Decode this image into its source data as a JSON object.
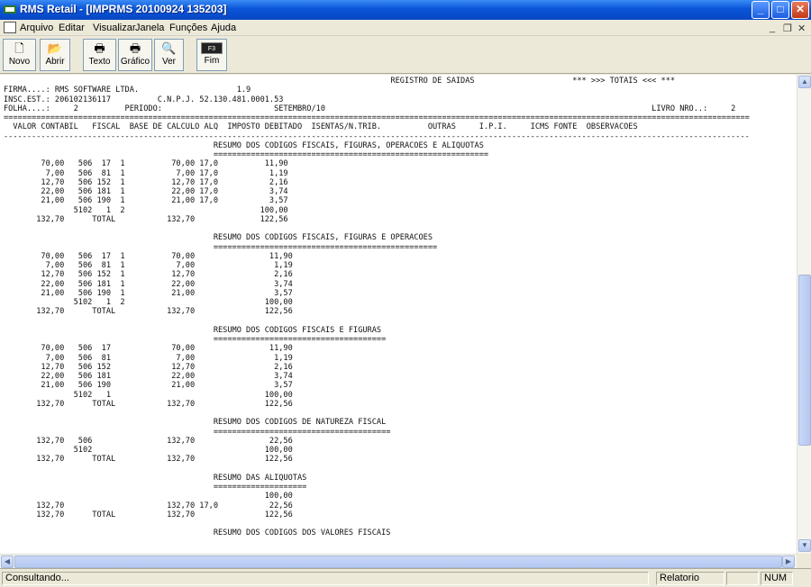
{
  "window": {
    "title": "RMS Retail - [IMPRMS 20100924 135203]",
    "controls": {
      "minimize": "_",
      "maximize": "□",
      "close": "✕"
    }
  },
  "menu": {
    "items": [
      "Arquivo",
      "Editar",
      "Visualizar",
      "Janela",
      "Funções",
      "Ajuda"
    ],
    "mdi_controls": {
      "minimize": "_",
      "restore": "❐",
      "close": "✕"
    }
  },
  "toolbar": {
    "buttons": [
      {
        "label": "Novo",
        "icon": "new-document-icon",
        "glyph": "🗋"
      },
      {
        "label": "Abrir",
        "icon": "open-folder-icon",
        "glyph": "📂"
      },
      {
        "label": "Texto",
        "icon": "print-text-icon",
        "glyph": "🖶"
      },
      {
        "label": "Gráfico",
        "icon": "print-graphic-icon",
        "glyph": "🖶"
      },
      {
        "label": "Ver",
        "icon": "preview-icon",
        "glyph": "🔍"
      },
      {
        "label": "Fim",
        "icon": "f3-key-icon",
        "glyph": "F3"
      }
    ]
  },
  "report": {
    "lines": [
      "                                                                                   REGISTRO DE SAIDAS                     *** >>> TOTAIS <<< ***",
      "FIRMA....: RMS SOFTWARE LTDA.                     1.9",
      "INSC.EST.: 206102136117          C.N.P.J. 52.130.481.0001.53",
      "FOLHA....:     2          PERIODO:                        SETEMBRO/10                                                                      LIVRO NRO..:     2",
      "================================================================================================================================================================",
      "  VALOR CONTABIL   FISCAL  BASE DE CALCULO ALQ  IMPOSTO DEBITADO  ISENTAS/N.TRIB.          OUTRAS     I.P.I.     ICMS FONTE  OBSERVACOES",
      "----------------------------------------------------------------------------------------------------------------------------------------------------------------",
      "                                             RESUMO DOS CODIGOS FISCAIS, FIGURAS, OPERACOES E ALIQUOTAS",
      "                                             ===========================================================",
      "        70,00   506  17  1          70,00 17,0          11,90",
      "         7,00   506  81  1           7,00 17,0           1,19",
      "        12,70   506 152  1          12,70 17,0           2,16",
      "        22,00   506 181  1          22,00 17,0           3,74",
      "        21,00   506 190  1          21,00 17,0           3,57",
      "               5102   1  2                             100,00",
      "       132,70      TOTAL           132,70              122,56",
      "",
      "                                             RESUMO DOS CODIGOS FISCAIS, FIGURAS E OPERACOES",
      "                                             ================================================",
      "        70,00   506  17  1          70,00                11,90",
      "         7,00   506  81  1           7,00                 1,19",
      "        12,70   506 152  1          12,70                 2,16",
      "        22,00   506 181  1          22,00                 3,74",
      "        21,00   506 190  1          21,00                 3,57",
      "               5102   1  2                              100,00",
      "       132,70      TOTAL           132,70               122,56",
      "",
      "                                             RESUMO DOS CODIGOS FISCAIS E FIGURAS",
      "                                             =====================================",
      "        70,00   506  17             70,00                11,90",
      "         7,00   506  81              7,00                 1,19",
      "        12,70   506 152             12,70                 2,16",
      "        22,00   506 181             22,00                 3,74",
      "        21,00   506 190             21,00                 3,57",
      "               5102   1                                 100,00",
      "       132,70      TOTAL           132,70               122,56",
      "",
      "                                             RESUMO DOS CODIGOS DE NATUREZA FISCAL",
      "                                             ======================================",
      "       132,70   506                132,70                22,56",
      "               5102                                     100,00",
      "       132,70      TOTAL           132,70               122,56",
      "",
      "                                             RESUMO DAS ALIQUOTAS",
      "                                             ====================",
      "                                                        100,00",
      "       132,70                      132,70 17,0           22,56",
      "       132,70      TOTAL           132,70               122,56",
      "",
      "                                             RESUMO DOS CODIGOS DOS VALORES FISCAIS"
    ]
  },
  "status": {
    "message": "Consultando...",
    "mode": "Relatorio",
    "empty": "",
    "numlock": "NUM"
  }
}
